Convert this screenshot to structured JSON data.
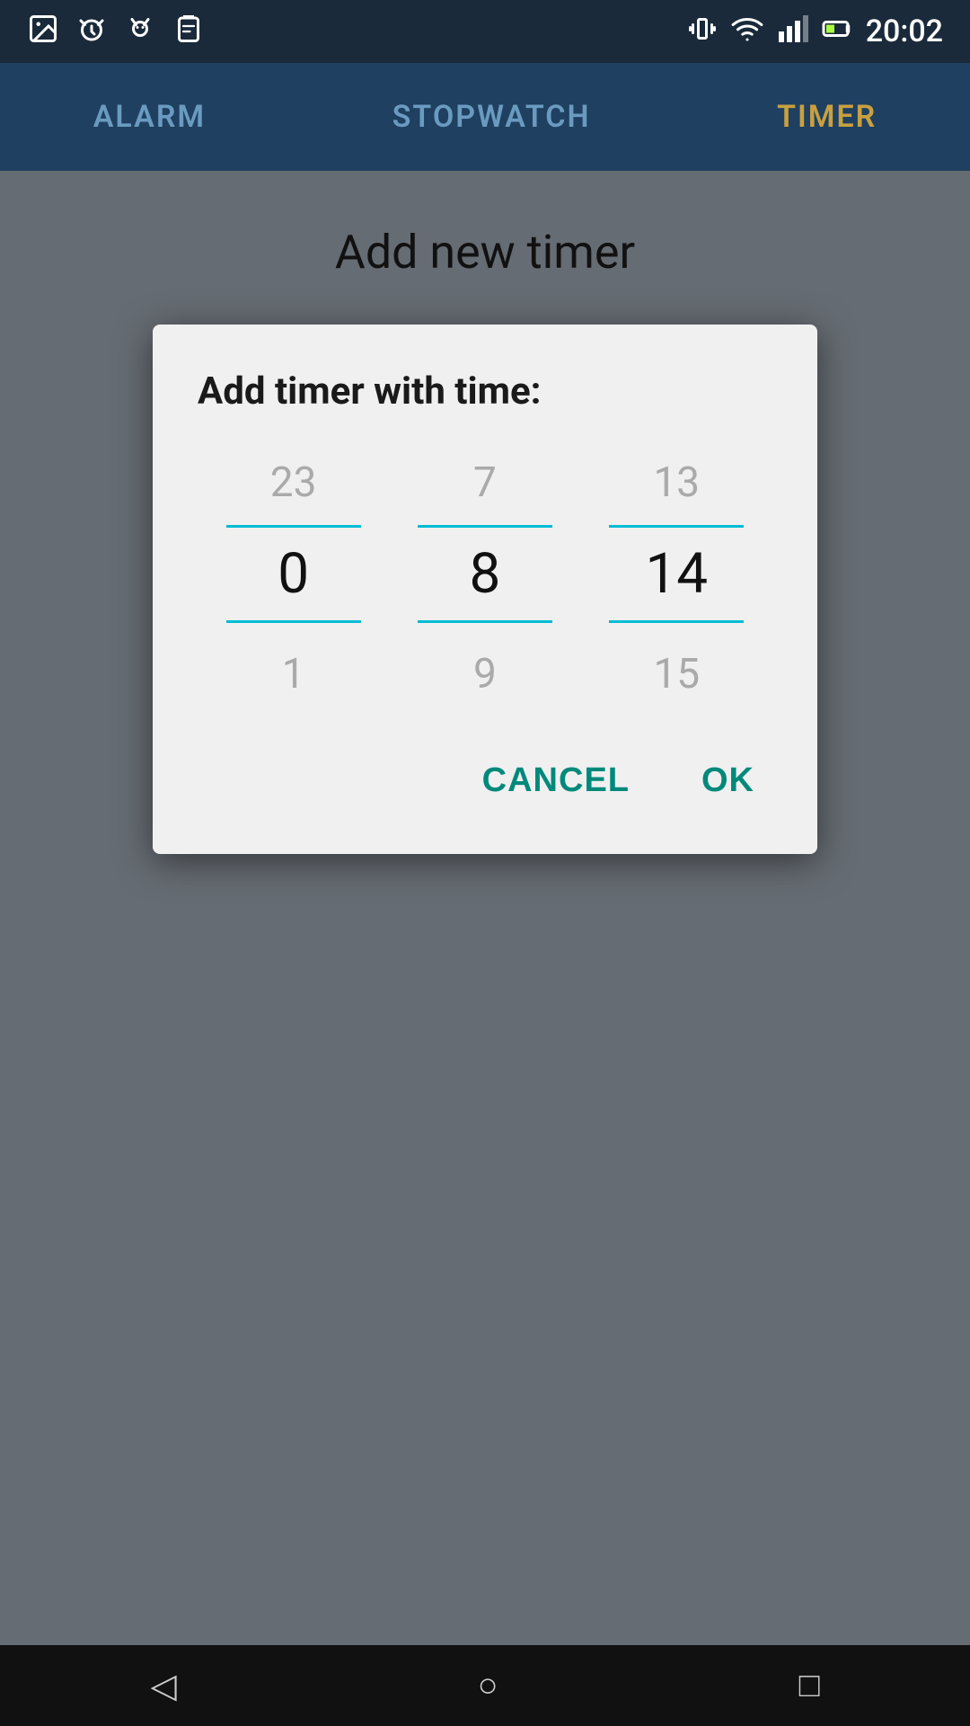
{
  "statusBar": {
    "time": "20:02",
    "icons": [
      "image",
      "alarm",
      "cat",
      "clipboard",
      "vibrate",
      "wifi",
      "signal",
      "battery"
    ]
  },
  "tabs": [
    {
      "id": "alarm",
      "label": "ALARM",
      "active": false
    },
    {
      "id": "stopwatch",
      "label": "STOPWATCH",
      "active": false
    },
    {
      "id": "timer",
      "label": "TIMER",
      "active": true
    }
  ],
  "pageTitle": "Add new timer",
  "dialog": {
    "title": "Add timer with time:",
    "picker": {
      "hours": {
        "above": "23",
        "selected": "0",
        "below": "1"
      },
      "minutes": {
        "above": "7",
        "selected": "8",
        "below": "9"
      },
      "seconds": {
        "above": "13",
        "selected": "14",
        "below": "15"
      }
    },
    "cancelLabel": "CANCEL",
    "okLabel": "OK"
  },
  "navBar": {
    "back": "◁",
    "home": "○",
    "recent": "□"
  },
  "colors": {
    "accent": "#00897b",
    "tabActive": "#c8a040",
    "tabInactive": "#6a9abf",
    "appBar": "#1f4060",
    "statusBar": "#1a2a3a",
    "pickerLine": "#00bcd4"
  }
}
